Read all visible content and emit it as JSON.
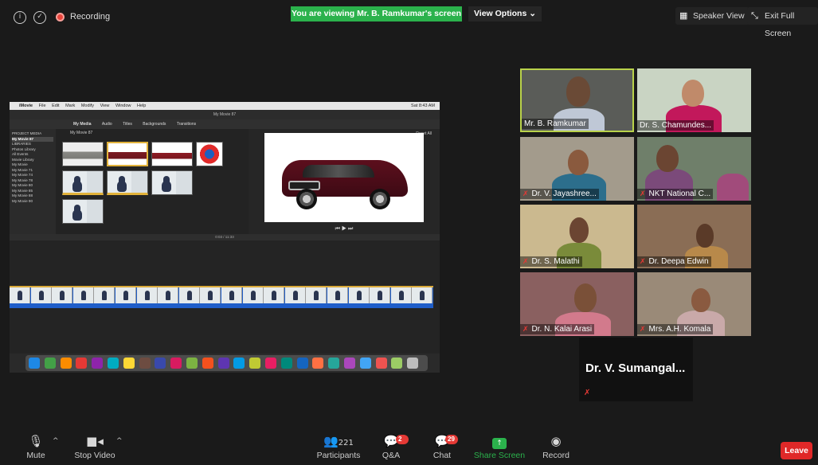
{
  "topbar": {
    "recording_label": "Recording",
    "banner": "You are viewing Mr. B. Ramkumar's screen",
    "view_options": "View Options ⌄",
    "speaker_view": "Speaker View",
    "exit_fullscreen": "Exit Full Screen"
  },
  "shared_screen": {
    "mac_menu": [
      "iMovie",
      "File",
      "Edit",
      "Mark",
      "Modify",
      "View",
      "Window",
      "Help"
    ],
    "mac_status": "Sat 8:43 AM",
    "imovie_title": "My Movie 87",
    "browser_tabs": [
      "My Media",
      "Audio",
      "Titles",
      "Backgrounds",
      "Transitions"
    ],
    "browser_heading": "My Movie 87",
    "sidebar": [
      "PROJECT MEDIA",
      "My Movie 87",
      "LIBRARIES",
      "Photos Library",
      "All Events",
      "Movie Library",
      "My Movie",
      "My Movie 71",
      "My Movie 74",
      "My Movie 78",
      "My Movie 80",
      "My Movie 85",
      "My Movie 88",
      "My Movie 90"
    ],
    "reset_all": "Reset All",
    "timecode": "0:03 / 11:33",
    "settings": "Settings"
  },
  "gallery": [
    {
      "name": "Mr. B. Ramkumar",
      "muted": false,
      "active": true
    },
    {
      "name": "Dr. S. Chamundes...",
      "muted": false,
      "active": false
    },
    {
      "name": "Dr. V. Jayashree...",
      "muted": true,
      "active": false
    },
    {
      "name": "NKT National C...",
      "muted": true,
      "active": false
    },
    {
      "name": "Dr. S. Malathi",
      "muted": true,
      "active": false
    },
    {
      "name": "Dr. Deepa Edwin",
      "muted": true,
      "active": false
    },
    {
      "name": "Dr. N. Kalai Arasi",
      "muted": true,
      "active": false
    },
    {
      "name": "Mrs. A.H. Komala",
      "muted": true,
      "active": false
    }
  ],
  "big_tile": {
    "name": "Dr. V. Sumangal...",
    "muted": true
  },
  "toolbar": {
    "mute": "Mute",
    "stop_video": "Stop Video",
    "participants": "Participants",
    "participants_count": "221",
    "qa": "Q&A",
    "qa_badge": "2",
    "chat": "Chat",
    "chat_badge": "29",
    "share_screen": "Share Screen",
    "record": "Record",
    "leave": "Leave"
  },
  "colors": {
    "banner_green": "#2bb24c",
    "active_speaker_border": "#b9d24a",
    "leave_red": "#e02828",
    "badge_red": "#e53935"
  }
}
